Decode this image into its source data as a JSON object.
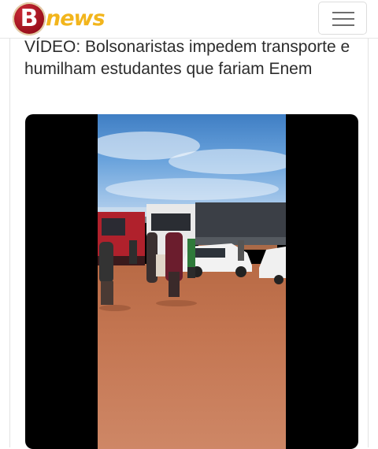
{
  "header": {
    "logo_letter": "B",
    "logo_text": "news",
    "menu_icon": "hamburger-menu-icon"
  },
  "article": {
    "title": "VÍDEO: Bolsonaristas impedem transporte e humilham estudantes que fariam Enem"
  },
  "colors": {
    "logo_red": "#a3141f",
    "logo_yellow": "#f2b51c",
    "text": "#2c2c2c"
  }
}
